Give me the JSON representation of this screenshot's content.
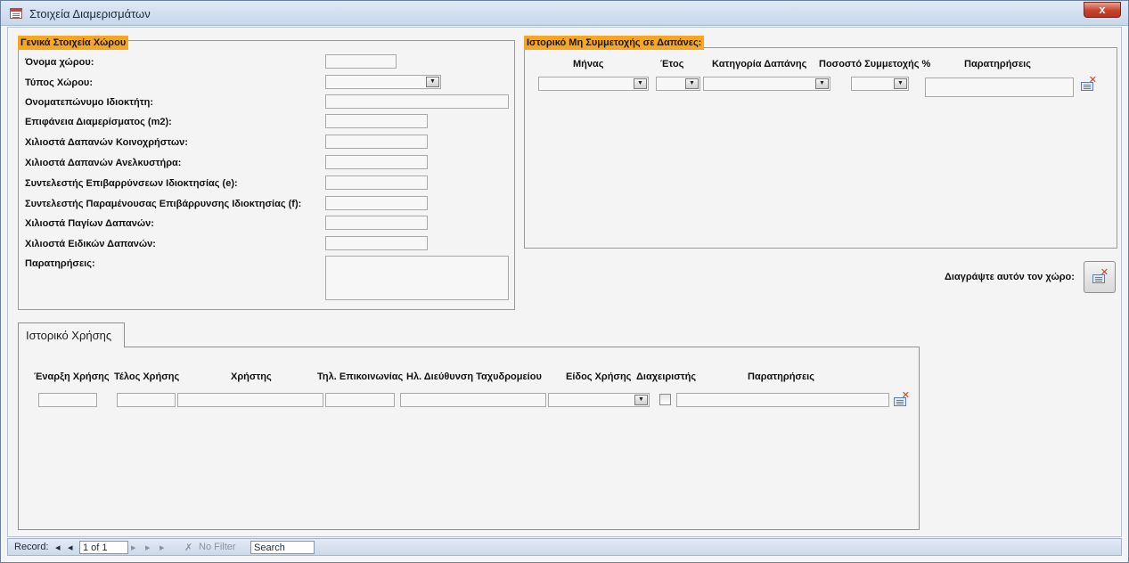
{
  "window": {
    "title": "Στοιχεία Διαμερισμάτων",
    "close_glyph": "x"
  },
  "general": {
    "title": "Γενικά Στοιχεία Χώρου",
    "fields": {
      "name": "Όνομα χώρου:",
      "type": "Τύπος Χώρου:",
      "owner": "Ονοματεπώνυμο Ιδιοκτήτη:",
      "area": "Επιφάνεια Διαμερίσματος (m2):",
      "common_mills": "Χιλιοστά Δαπανών Κοινοχρήστων:",
      "elevator_mills": "Χιλιοστά Δαπανών Ανελκυστήρα:",
      "coef_e": "Συντελεστής Επιβαρρύνσεων Ιδιοκτησίας (e):",
      "coef_f": "Συντελεστής Παραμένουσας Επιβάρρυνσης Ιδιοκτησίας (f):",
      "fixed_mills": "Χιλιοστά Παγίων Δαπανών:",
      "special_mills": "Χιλιοστά Ειδικών Δαπανών:",
      "notes": "Παρατηρήσεις:"
    }
  },
  "nonparticipation": {
    "title": "Ιστορικό Μη Συμμετοχής σε Δαπάνες:",
    "columns": {
      "month": "Μήνας",
      "year": "Έτος",
      "category": "Κατηγορία Δαπάνης",
      "percent": "Ποσοστό Συμμετοχής %",
      "notes": "Παρατηρήσεις"
    }
  },
  "delete_space": {
    "label": "Διαγράψτε αυτόν τον χώρο:"
  },
  "usage": {
    "tab_label": "Ιστορικό Χρήσης",
    "columns": {
      "start": "Έναρξη Χρήσης",
      "end": "Τέλος Χρήσης",
      "user": "Χρήστης",
      "phone": "Τηλ. Επικοινωνίας",
      "email": "Ηλ. Διεύθυνση Ταχυδρομείου",
      "type": "Είδος Χρήσης",
      "manager": "Διαχειριστής",
      "notes": "Παρατηρήσεις"
    }
  },
  "statusbar": {
    "record_label": "Record:",
    "first": "◂",
    "prev": "◂",
    "position": "1 of 1",
    "next": "▸",
    "last": "▸",
    "new": "▸",
    "filter_icon": "✗",
    "filter": "No Filter",
    "search": "Search"
  }
}
